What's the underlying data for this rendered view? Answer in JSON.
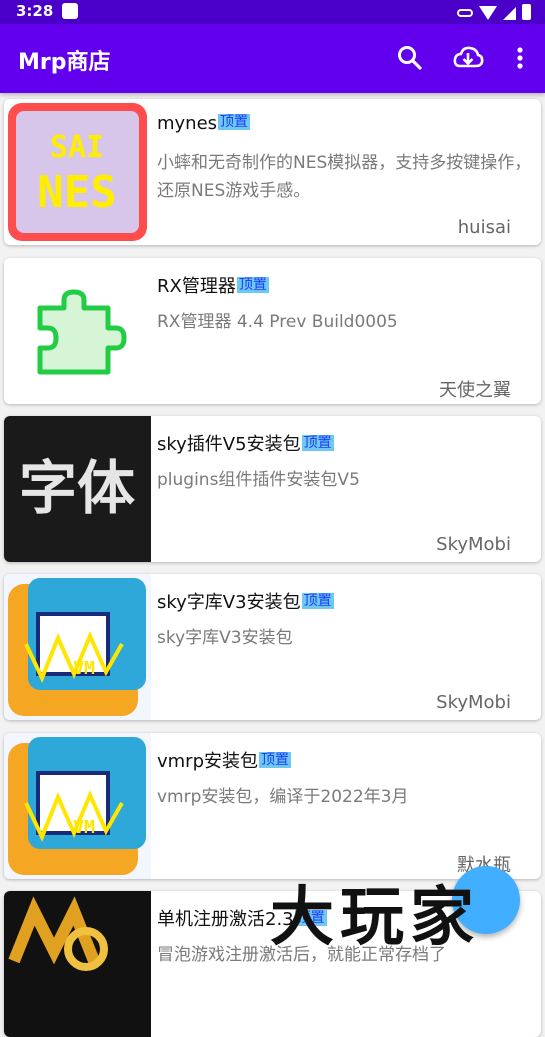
{
  "status_bar": {
    "time": "3:28"
  },
  "app_bar": {
    "title": "Mrp商店"
  },
  "items": [
    {
      "name": "mynes",
      "tag": "顶置",
      "desc": "小蟀和无奇制作的NES模拟器，支持多按键操作，还原NES游戏手感。",
      "author": "huisai"
    },
    {
      "name": "RX管理器",
      "tag": "顶置",
      "desc": "RX管理器 4.4 Prev Build0005",
      "author": "天使之翼"
    },
    {
      "name": "sky插件V5安装包",
      "tag": "顶置",
      "desc": "plugins组件插件安装包V5",
      "author": "SkyMobi"
    },
    {
      "name": "sky字库V3安装包",
      "tag": "顶置",
      "desc": "sky字库V3安装包",
      "author": "SkyMobi"
    },
    {
      "name": "vmrp安装包",
      "tag": "顶置",
      "desc": "vmrp安装包，编译于2022年3月",
      "author": "默水瓶"
    },
    {
      "name": "单机注册激活2.3",
      "tag": "顶置",
      "desc": "冒泡游戏注册激活后，就能正常存档了",
      "author": ""
    }
  ],
  "thumb_text": {
    "sainh": "SAI",
    "nes": "NES",
    "font": "字体",
    "vm": "VM"
  },
  "watermark": "大玩家",
  "colors": {
    "appbar": "#6200ee",
    "statusbar": "#4a00c8",
    "tag_bg": "#6ec8f0",
    "tag_text": "#1a3cff",
    "fab": "#42aeff"
  },
  "icons": {
    "search": "search-icon",
    "download": "cloud-download-icon",
    "menu": "more-vert-icon"
  }
}
